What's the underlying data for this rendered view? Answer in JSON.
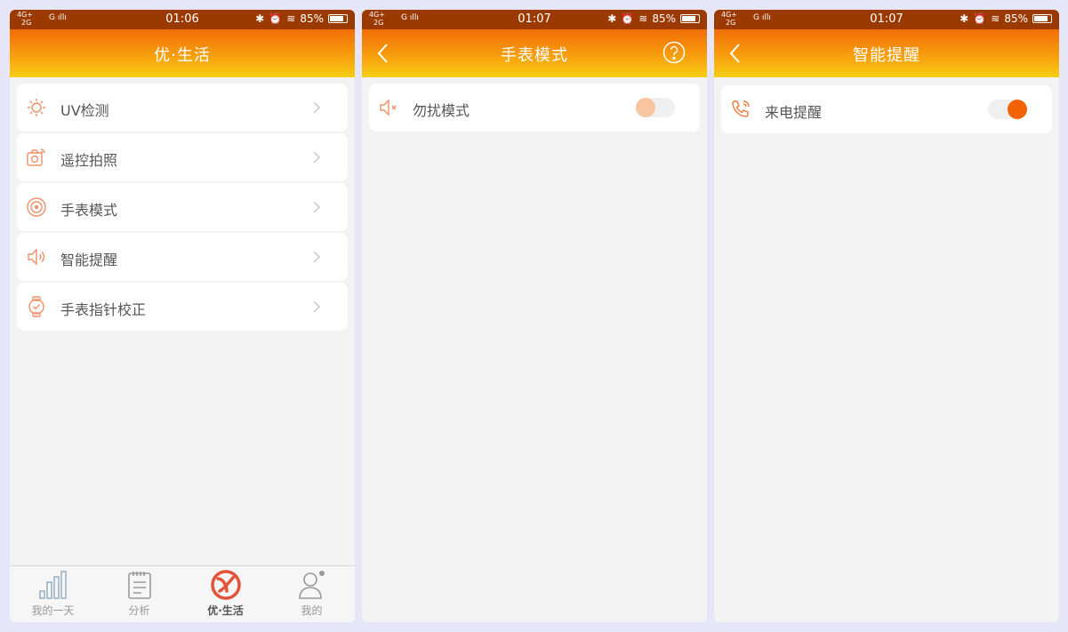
{
  "screens": [
    {
      "status": {
        "network_top": "4G+",
        "network_bottom": "2G",
        "sim2": "G",
        "time": "01:06",
        "battery": "85%"
      },
      "nav": {
        "title": "优·生活"
      },
      "menu": [
        {
          "label": "UV检测",
          "icon": "sun-icon"
        },
        {
          "label": "遥控拍照",
          "icon": "camera-icon"
        },
        {
          "label": "手表模式",
          "icon": "watch-mode-icon"
        },
        {
          "label": "智能提醒",
          "icon": "speaker-icon"
        },
        {
          "label": "手表指针校正",
          "icon": "watch-icon"
        }
      ],
      "tabs": [
        {
          "label": "我的一天",
          "icon": "bar-chart-icon"
        },
        {
          "label": "分析",
          "icon": "notepad-icon"
        },
        {
          "label": "优·生活",
          "icon": "brand-logo-icon",
          "active": true
        },
        {
          "label": "我的",
          "icon": "person-icon"
        }
      ]
    },
    {
      "status": {
        "network_top": "4G+",
        "network_bottom": "2G",
        "sim2": "G",
        "time": "01:07",
        "battery": "85%"
      },
      "nav": {
        "title": "手表模式"
      },
      "setting": {
        "label": "勿扰模式",
        "icon": "mute-speaker-icon",
        "enabled": false
      }
    },
    {
      "status": {
        "network_top": "4G+",
        "network_bottom": "2G",
        "sim2": "G",
        "time": "01:07",
        "battery": "85%"
      },
      "nav": {
        "title": "智能提醒"
      },
      "setting": {
        "label": "来电提醒",
        "icon": "phone-ring-icon",
        "enabled": true
      }
    }
  ],
  "colors": {
    "accent": "#f26207",
    "icon_stroke": "#f0906a",
    "status_bar": "#9b3a00",
    "background": "#e6e6f8"
  }
}
